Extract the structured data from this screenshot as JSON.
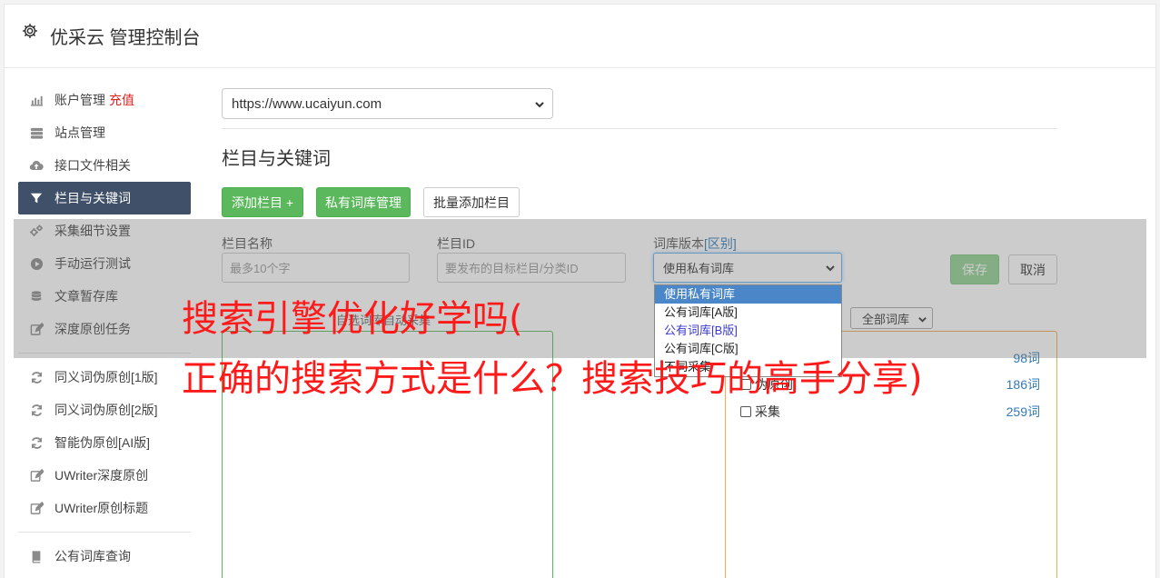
{
  "header": {
    "title": "优采云 管理控制台"
  },
  "sidebar": {
    "items": [
      {
        "label": "账户管理",
        "badge": "充值",
        "icon": "bar-chart-icon"
      },
      {
        "label": "站点管理",
        "icon": "server-icon"
      },
      {
        "label": "接口文件相关",
        "icon": "cloud-upload-icon"
      },
      {
        "label": "栏目与关键词",
        "icon": "filter-icon",
        "active": true
      },
      {
        "label": "采集细节设置",
        "icon": "gears-icon"
      },
      {
        "label": "手动运行测试",
        "icon": "play-circle-icon"
      },
      {
        "label": "文章暂存库",
        "icon": "database-icon"
      },
      {
        "label": "深度原创任务",
        "icon": "edit-icon"
      },
      {
        "label": "同义词伪原创[1版]",
        "icon": "refresh-icon"
      },
      {
        "label": "同义词伪原创[2版]",
        "icon": "refresh-icon"
      },
      {
        "label": "智能伪原创[AI版]",
        "icon": "refresh-icon"
      },
      {
        "label": "UWriter深度原创",
        "icon": "edit-icon"
      },
      {
        "label": "UWriter原创标题",
        "icon": "edit-icon"
      },
      {
        "label": "公有词库查询",
        "icon": "book-icon"
      }
    ]
  },
  "main": {
    "site_select": "https://www.ucaiyun.com",
    "section_title": "栏目与关键词",
    "buttons": {
      "add_column": "添加栏目 +",
      "private_lib": "私有词库管理",
      "batch_add": "批量添加栏目"
    },
    "form": {
      "name_label": "栏目名称",
      "name_placeholder": "最多10个字",
      "id_label": "栏目ID",
      "id_placeholder": "要发布的目标栏目/分类ID",
      "version_label": "词库版本",
      "version_diff": "[区别]",
      "version_value": "使用私有词库",
      "save": "保存",
      "cancel": "取消"
    },
    "dropdown_options": [
      "使用私有词库",
      "公有词库[A版]",
      "公有词库[B版]",
      "公有词库[C版]",
      "不同采集"
    ],
    "left_box_title": "自选词库自动采集",
    "lib_filter": "全部词库",
    "libraries": [
      {
        "name": "",
        "count": "98词"
      },
      {
        "name": "伪原创",
        "count": "186词"
      },
      {
        "name": "采集",
        "count": "259词"
      }
    ]
  },
  "watermark": {
    "line1": "搜索引擎优化好学吗(",
    "line2": "正确的搜索方式是什么？搜索技巧的高手分享)"
  }
}
